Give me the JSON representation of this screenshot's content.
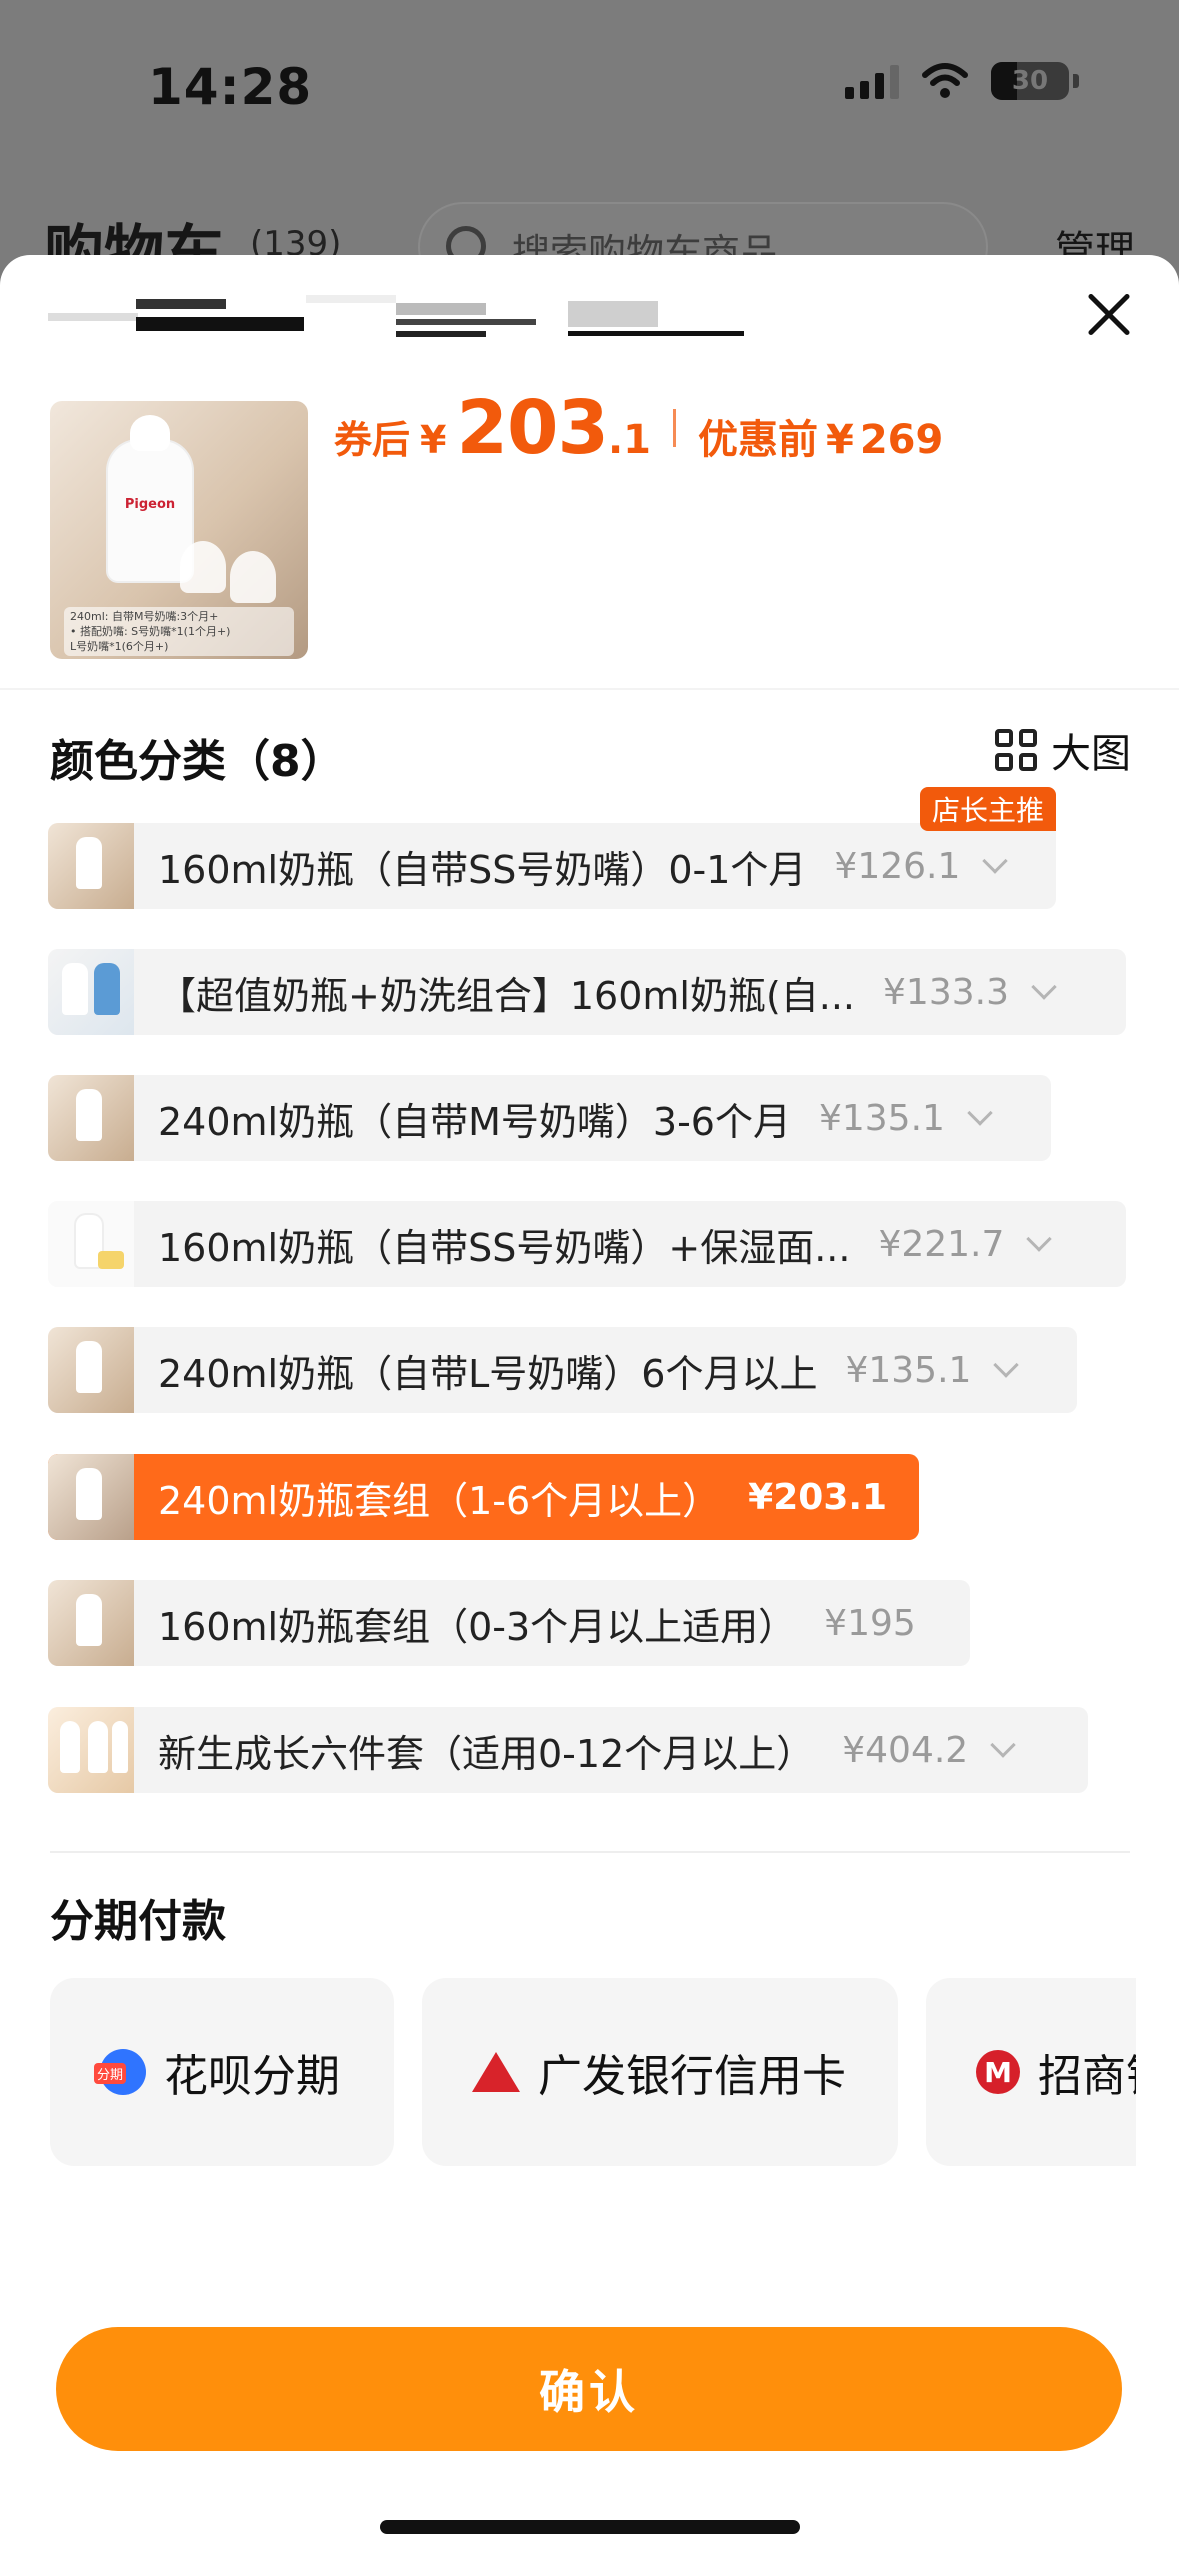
{
  "status_bar": {
    "time": "14:28",
    "battery": "30"
  },
  "background_page": {
    "title": "购物车",
    "count": "(139)",
    "search_placeholder": "搜索购物车商品",
    "manage": "管理"
  },
  "product": {
    "image_caption_lines": [
      "240ml: 自带M号奶嘴:3个月+",
      "• 搭配奶嘴: S号奶嘴*1(1个月+)",
      "L号奶嘴*1(6个月+)"
    ],
    "coupon_price_label": "券后",
    "currency": "¥",
    "coupon_price_int": "203",
    "coupon_price_dec": ".1",
    "orig_price_label": "优惠前",
    "orig_price": "269"
  },
  "variants_section": {
    "title": "颜色分类（8）",
    "big_image_label": "大图",
    "items": [
      {
        "label": "160ml奶瓶（自带SS号奶嘴）0-1个月",
        "price": "¥126.1",
        "badge": "店长主推",
        "selected": false
      },
      {
        "label": "【超值奶瓶+奶洗组合】160ml奶瓶(自...",
        "price": "¥133.3",
        "badge": "",
        "selected": false
      },
      {
        "label": "240ml奶瓶（自带M号奶嘴）3-6个月",
        "price": "¥135.1",
        "badge": "",
        "selected": false
      },
      {
        "label": "160ml奶瓶（自带SS号奶嘴）+保湿面...",
        "price": "¥221.7",
        "badge": "",
        "selected": false
      },
      {
        "label": "240ml奶瓶（自带L号奶嘴）6个月以上",
        "price": "¥135.1",
        "badge": "",
        "selected": false
      },
      {
        "label": "240ml奶瓶套组（1-6个月以上）",
        "price": "¥203.1",
        "badge": "",
        "selected": true
      },
      {
        "label": "160ml奶瓶套组（0-3个月以上适用）",
        "price": "¥195",
        "badge": "",
        "selected": false
      },
      {
        "label": "新生成长六件套（适用0-12个月以上）",
        "price": "¥404.2",
        "badge": "",
        "selected": false
      }
    ]
  },
  "installments": {
    "title": "分期付款",
    "options": [
      {
        "label": "花呗分期",
        "icon": "huabei-icon",
        "icon_text": "分期"
      },
      {
        "label": "广发银行信用卡",
        "icon": "cgb-bank-icon"
      },
      {
        "label": "招商银行信用卡",
        "icon": "cmb-bank-icon"
      }
    ]
  },
  "confirm_label": "确认",
  "colors": {
    "accent": "#f25a0c",
    "selected": "#ff6a1a",
    "confirm": "#ff8f0b"
  }
}
